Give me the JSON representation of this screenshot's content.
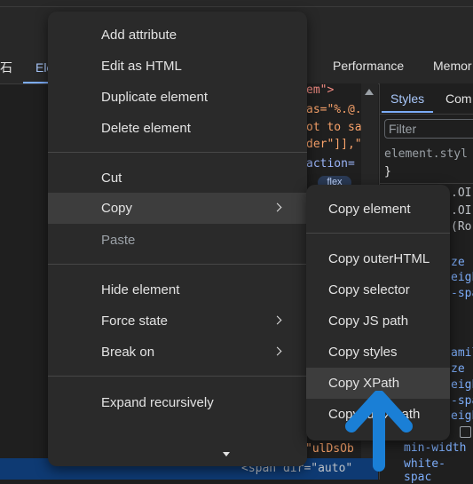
{
  "devtools_tabs": {
    "partial_left": "石",
    "elements": "Ele",
    "performance": "Performance",
    "memory": "Memor"
  },
  "elements_code": {
    "line1": "em\">",
    "line2": "as=\"%.@.",
    "line3": "ot to sa",
    "line4": "der\"]],\"",
    "line5": "action=",
    "flex_badge": "flex",
    "bottom_line1": "\"ulDsOb",
    "bottom_line2": "<span dir=\"auto\""
  },
  "styles_pane": {
    "tab_styles": "Styles",
    "tab_computed": "Com",
    "filter_placeholder": "Filter",
    "element_style": "element.styl",
    "brace": "}",
    "frag1": ".OI",
    "frag2": ".OI",
    "frag3": "(Ro",
    "frag4": "ze",
    "frag5": "eigh",
    "frag6": "-spa",
    "frag7": "amil",
    "frag8": "ze",
    "frag9": "eigh",
    "frag10": "-spa",
    "frag11": "eigh",
    "min_width": "min-width",
    "white_space": "white-spac"
  },
  "context_menu": {
    "add_attribute": "Add attribute",
    "edit_as_html": "Edit as HTML",
    "duplicate_element": "Duplicate element",
    "delete_element": "Delete element",
    "cut": "Cut",
    "copy": "Copy",
    "paste": "Paste",
    "hide_element": "Hide element",
    "force_state": "Force state",
    "break_on": "Break on",
    "expand_recursively": "Expand recursively"
  },
  "copy_submenu": {
    "copy_element": "Copy element",
    "copy_outerhtml": "Copy outerHTML",
    "copy_selector": "Copy selector",
    "copy_js_path": "Copy JS path",
    "copy_styles": "Copy styles",
    "copy_xpath": "Copy XPath",
    "copy_full_xpath": "Copy full XPath"
  },
  "colors": {
    "accent": "#7cacf8",
    "annotation_arrow": "#1a7fd6",
    "menu_bg": "#2a2a2a",
    "selection": "#0e3a73"
  }
}
